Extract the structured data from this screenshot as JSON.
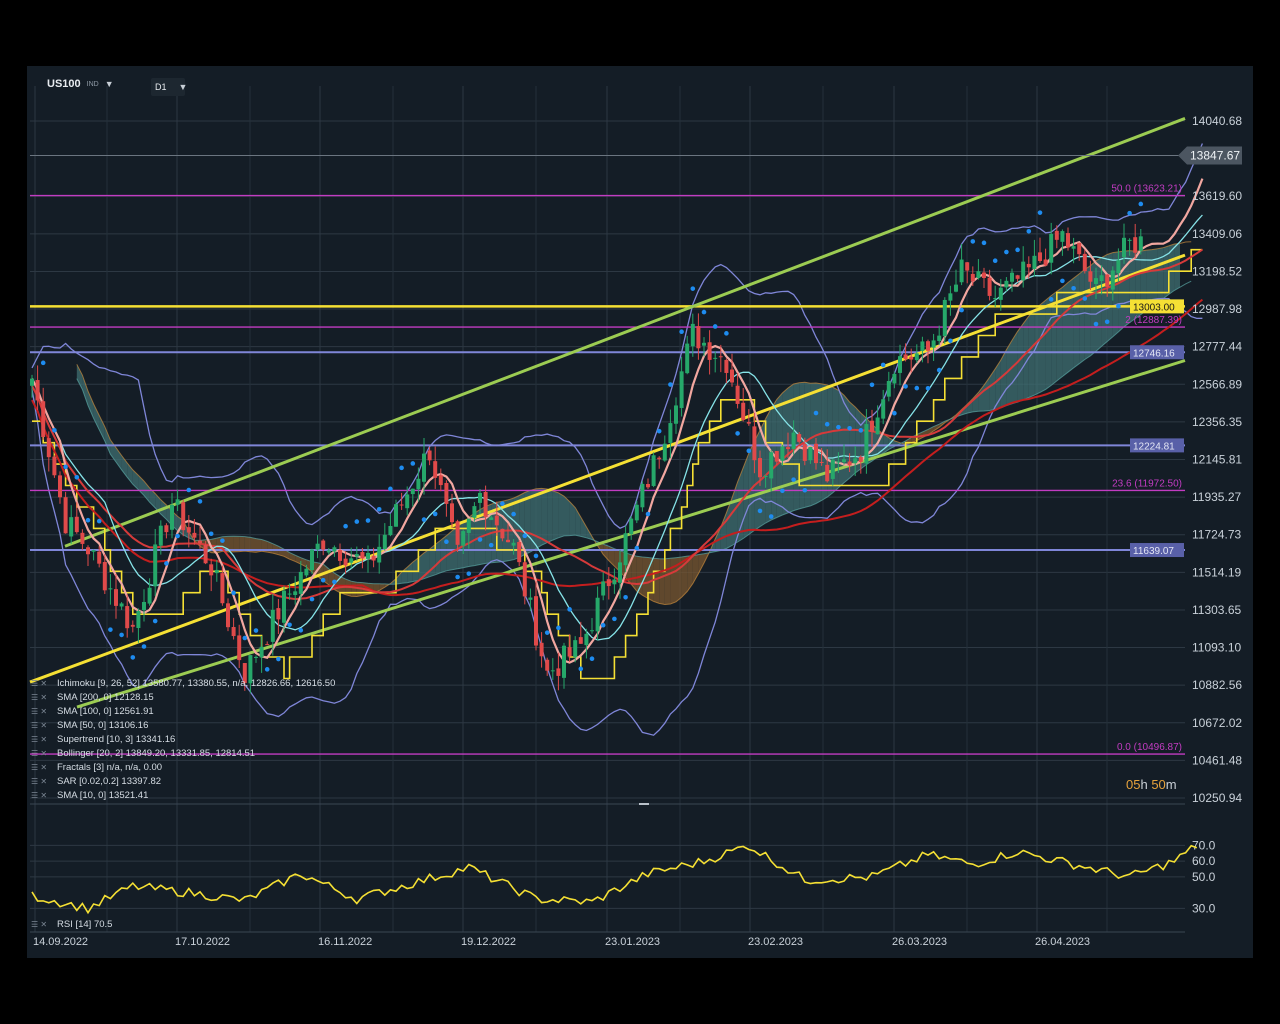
{
  "toolbar": {
    "symbol": "US100",
    "symbol_sub": "IND",
    "timeframe": "D1"
  },
  "timer": {
    "hours": "05",
    "h_unit": "h",
    "minutes": "50",
    "m_unit": "m"
  },
  "legend": [
    "Ichimoku  [9, 26, 52]  13580.77,  13380.55,  n/a,  12826.66,  12616.50",
    "SMA  [200, 0]  12128.15",
    "SMA  [100, 0]  12561.91",
    "SMA  [50, 0]  13106.16",
    "Supertrend  [10, 3]  13341.16",
    "Bollinger  [20, 2]  13849.20,  13331.85,  12814.51",
    "Fractals  [3]  n/a,  n/a,  0.00",
    "SAR  [0.02,0.2]  13397.82",
    "SMA  [10, 0]  13521.41"
  ],
  "rsi_legend": "RSI  [14]  70.5",
  "chart_data": {
    "type": "candlestick",
    "symbol": "US100",
    "timeframe": "D1",
    "last_price": 13847.67,
    "last_price_label": "13847.67",
    "y_ticks": [
      "14040.68",
      "13619.60",
      "13409.06",
      "13198.52",
      "12987.98",
      "12777.44",
      "12566.89",
      "12356.35",
      "12145.81",
      "11935.27",
      "11724.73",
      "11514.19",
      "11303.65",
      "11093.10",
      "10882.56",
      "10672.02",
      "10461.48",
      "10250.94"
    ],
    "ylim": [
      10250.94,
      14040.68
    ],
    "x_ticks": [
      "14.09.2022",
      "17.10.2022",
      "16.11.2022",
      "19.12.2022",
      "23.01.2023",
      "23.02.2023",
      "26.03.2023",
      "26.04.2023"
    ],
    "bars": 160,
    "close_anchors": [
      [
        0,
        12600
      ],
      [
        6,
        11800
      ],
      [
        10,
        11650
      ],
      [
        18,
        11200
      ],
      [
        25,
        11900
      ],
      [
        32,
        11550
      ],
      [
        38,
        10950
      ],
      [
        45,
        11350
      ],
      [
        52,
        11700
      ],
      [
        60,
        11550
      ],
      [
        66,
        11900
      ],
      [
        71,
        12200
      ],
      [
        76,
        11600
      ],
      [
        80,
        11950
      ],
      [
        86,
        11650
      ],
      [
        92,
        10950
      ],
      [
        98,
        11100
      ],
      [
        106,
        11700
      ],
      [
        112,
        12200
      ],
      [
        118,
        12850
      ],
      [
        124,
        12700
      ],
      [
        130,
        12100
      ],
      [
        136,
        12300
      ],
      [
        142,
        12050
      ],
      [
        148,
        12200
      ],
      [
        154,
        12700
      ],
      [
        160,
        12750
      ],
      [
        166,
        13200
      ],
      [
        172,
        13050
      ],
      [
        178,
        13200
      ],
      [
        184,
        13400
      ],
      [
        190,
        13100
      ],
      [
        196,
        13350
      ],
      [
        202,
        13400
      ],
      [
        208,
        13850
      ]
    ],
    "horizontal_levels": [
      {
        "price": 13623.21,
        "label": "50.0 (13623.21)",
        "color": "#c23cc2"
      },
      {
        "price": 13003.0,
        "label": "13003.00",
        "color": "#f5e034"
      },
      {
        "price": 12887.39,
        "label": "2 (12887.39)",
        "color": "#c23cc2"
      },
      {
        "price": 12746.16,
        "label": "12746.16",
        "color": "#7f86d8"
      },
      {
        "price": 12224.81,
        "label": "12224.81",
        "color": "#7f86d8"
      },
      {
        "price": 11972.5,
        "label": "23.6 (11972.50)",
        "color": "#c23cc2"
      },
      {
        "price": 11639.07,
        "label": "11639.07",
        "color": "#7f86d8"
      },
      {
        "price": 10496.87,
        "label": "0.0 (10496.87)",
        "color": "#c23cc2"
      }
    ],
    "rsi": {
      "period": 14,
      "last": 70.5,
      "y_ticks": [
        "70.0",
        "60.0",
        "50.0",
        "30.0"
      ],
      "anchors": [
        [
          0,
          38
        ],
        [
          10,
          30
        ],
        [
          18,
          44
        ],
        [
          28,
          40
        ],
        [
          38,
          35
        ],
        [
          48,
          52
        ],
        [
          58,
          36
        ],
        [
          68,
          46
        ],
        [
          78,
          56
        ],
        [
          90,
          36
        ],
        [
          100,
          34
        ],
        [
          110,
          52
        ],
        [
          120,
          60
        ],
        [
          128,
          70
        ],
        [
          138,
          48
        ],
        [
          150,
          50
        ],
        [
          160,
          64
        ],
        [
          168,
          58
        ],
        [
          176,
          66
        ],
        [
          186,
          58
        ],
        [
          196,
          50
        ],
        [
          204,
          60
        ],
        [
          208,
          70
        ]
      ]
    },
    "colors": {
      "bull": "#26a86a",
      "bear": "#e04a4a",
      "channel": "#9ccc52",
      "trendline": "#f5e034",
      "sma200": "#c41e1e",
      "sma100": "#d63a3a",
      "sma10": "#f2a7a0",
      "bollinger": "#7f86d8",
      "supertrend": "#f5e034",
      "sar": "#1e8cf0",
      "rsi": "#f5e034",
      "cloud_bear": "#7a5730",
      "cloud_bull": "#3f6f72"
    }
  }
}
